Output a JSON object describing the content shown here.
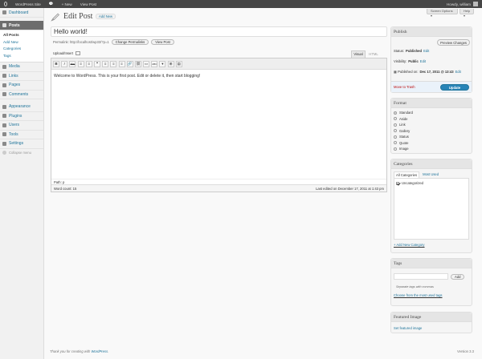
{
  "adminbar": {
    "site_name": "WordPress Site",
    "new_label": "New",
    "view_post": "View Post",
    "howdy": "Howdy, william"
  },
  "screen_meta": {
    "options": "Screen Options",
    "help": "Help"
  },
  "menu": {
    "dashboard": "Dashboard",
    "posts": "Posts",
    "posts_sub": [
      "All Posts",
      "Add New",
      "Categories",
      "Tags"
    ],
    "media": "Media",
    "links": "Links",
    "pages": "Pages",
    "comments": "Comments",
    "appearance": "Appearance",
    "plugins": "Plugins",
    "users": "Users",
    "tools": "Tools",
    "settings": "Settings",
    "collapse": "Collapse menu"
  },
  "header": {
    "title": "Edit Post",
    "add_new": "Add New"
  },
  "post": {
    "title": "Hello world!",
    "permalink_label": "Permalink:",
    "permalink_url": "http://localhost/wp33/?p=1",
    "change_permalinks": "Change Permalinks",
    "view_post": "View Post",
    "upload_insert": "Upload/Insert",
    "tab_visual": "Visual",
    "tab_html": "HTML",
    "toolbar": [
      "B",
      "I",
      "abc",
      "≡",
      "≡",
      "❝",
      "≡",
      "≡",
      "≡",
      "🔗",
      "⛓",
      "▭",
      "ABC",
      "▾",
      "⊞",
      "▤"
    ],
    "content": "Welcome to WordPress. This is your first post. Edit or delete it, then start blogging!",
    "path_label": "Path:",
    "path_value": "p",
    "word_count": "Word count: 15",
    "last_edited": "Last edited on December 17, 2011 at 1:43 pm"
  },
  "publish": {
    "heading": "Publish",
    "preview": "Preview Changes",
    "status_label": "Status:",
    "status_value": "Published",
    "visibility_label": "Visibility:",
    "visibility_value": "Public",
    "published_label": "Published on:",
    "published_value": "Dec 17, 2011 @ 13:43",
    "edit": "Edit",
    "trash": "Move to Trash",
    "update": "Update"
  },
  "format": {
    "heading": "Format",
    "options": [
      "Standard",
      "Aside",
      "Link",
      "Gallery",
      "Status",
      "Quote",
      "Image"
    ],
    "selected": "Standard"
  },
  "categories": {
    "heading": "Categories",
    "tab_all": "All Categories",
    "tab_most": "Most Used",
    "items": [
      "Uncategorized"
    ],
    "add_new": "+ Add New Category"
  },
  "tags": {
    "heading": "Tags",
    "add": "Add",
    "hint": "Separate tags with commas",
    "choose": "Choose from the most used tags"
  },
  "featured": {
    "heading": "Featured Image",
    "link": "Set featured image"
  },
  "footer": {
    "thanks": "Thank you for creating with",
    "wp_link": "WordPress",
    "version": "Version 3.3"
  },
  "colors": {
    "adminbar": "#464646",
    "link": "#21759b",
    "update_button": "#2784b7",
    "trash": "#bc0b0b"
  }
}
